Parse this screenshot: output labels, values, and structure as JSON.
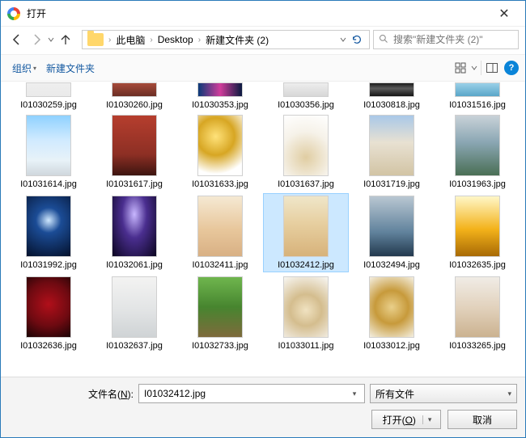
{
  "window": {
    "title": "打开"
  },
  "nav": {
    "breadcrumb": [
      "此电脑",
      "Desktop",
      "新建文件夹 (2)"
    ]
  },
  "search": {
    "placeholder": "搜索\"新建文件夹 (2)\""
  },
  "toolbar": {
    "organize": "组织",
    "newfolder": "新建文件夹"
  },
  "filename_label_pre": "文件名(",
  "filename_label_key": "N",
  "filename_label_post": "):",
  "filename_value": "I01032412.jpg",
  "filter_label": "所有文件",
  "open_label_pre": "打开(",
  "open_label_key": "O",
  "open_label_post": ")",
  "cancel_label": "取消",
  "selected_index": 9,
  "clip_row": [
    {
      "name": "I01030259.jpg",
      "bg": "linear-gradient(#eee,#eaeaea)"
    },
    {
      "name": "I01030260.jpg",
      "bg": "linear-gradient(#a64b3a,#6b2d24)"
    },
    {
      "name": "I01030353.jpg",
      "bg": "linear-gradient(90deg,#0b3a78,#d13c9b,#0a1a40)"
    },
    {
      "name": "I01030356.jpg",
      "bg": "linear-gradient(#ededed,#d7d7d7)"
    },
    {
      "name": "I01030818.jpg",
      "bg": "linear-gradient(180deg,#1a1a1a,#5a5a5a 40%,#151515)"
    },
    {
      "name": "I01031516.jpg",
      "bg": "linear-gradient(#9ad0e8,#5aa6c8)"
    }
  ],
  "files": [
    {
      "name": "I01031614.jpg",
      "bg": "linear-gradient(180deg,#8fd1ff 0%,#cfeaff 40%,#e8f2f8 75%,#cfd7dd 100%)"
    },
    {
      "name": "I01031617.jpg",
      "bg": "linear-gradient(180deg,#b63e2e 0%,#8d2f24 65%,#3d1510 100%)"
    },
    {
      "name": "I01031633.jpg",
      "bg": "radial-gradient(circle at 40% 35%,#ffe27a 0%,#d7a623 40%,#ffffff 80%)"
    },
    {
      "name": "I01031637.jpg",
      "bg": "radial-gradient(circle at 50% 70%,#e0cda2 0%,#f6f2e9 55%,#ffffff 100%)"
    },
    {
      "name": "I01031719.jpg",
      "bg": "linear-gradient(180deg,#a9c8e8 0%,#e8e1d2 45%,#d2c4a4 100%)"
    },
    {
      "name": "I01031963.jpg",
      "bg": "linear-gradient(180deg,#c9d2d8 0%,#8aa6b3 45%,#4a6f55 100%)"
    },
    {
      "name": "I01031992.jpg",
      "bg": "radial-gradient(circle at 50% 40%,#cfe8ff 0%,#1b4c96 30%,#04112c 100%)"
    },
    {
      "name": "I01032061.jpg",
      "bg": "radial-gradient(ellipse at 50% 30%,#c8b7ff 0%,#4a2e8f 40%,#0b0520 100%)"
    },
    {
      "name": "I01032411.jpg",
      "bg": "linear-gradient(180deg,#f5e9d3 0%,#e8c79c 55%,#d8b084 100%)"
    },
    {
      "name": "I01032412.jpg",
      "bg": "linear-gradient(180deg,#efe6c9 0%,#e7cfa0 45%,#d7b27a 100%)"
    },
    {
      "name": "I01032494.jpg",
      "bg": "linear-gradient(180deg,#b9c7d2 0%,#60829c 60%,#23394e 100%)"
    },
    {
      "name": "I01032635.jpg",
      "bg": "linear-gradient(180deg,#fff7c8 0%,#f3b21a 55%,#a86a05 100%)"
    },
    {
      "name": "I01032636.jpg",
      "bg": "radial-gradient(circle at 50% 45%,#b10f1a 0%,#6e0a11 55%,#1a0305 100%)"
    },
    {
      "name": "I01032637.jpg",
      "bg": "linear-gradient(180deg,#f3f3f2 0%,#e2e4e5 55%,#cfd3d5 100%)"
    },
    {
      "name": "I01032733.jpg",
      "bg": "linear-gradient(180deg,#6fb64e 0%,#47852f 50%,#7e6a3c 100%)"
    },
    {
      "name": "I01033011.jpg",
      "bg": "radial-gradient(circle at 50% 55%,#f0e2c1 0%,#d4bd8e 40%,#f8f7f4 100%)"
    },
    {
      "name": "I01033012.jpg",
      "bg": "radial-gradient(circle at 50% 50%,#e9cf8a 0%,#c79a3b 45%,#f4efe1 100%)"
    },
    {
      "name": "I01033265.jpg",
      "bg": "linear-gradient(180deg,#f0ece6 0%,#e2d2bd 50%,#cbb290 100%)"
    }
  ]
}
